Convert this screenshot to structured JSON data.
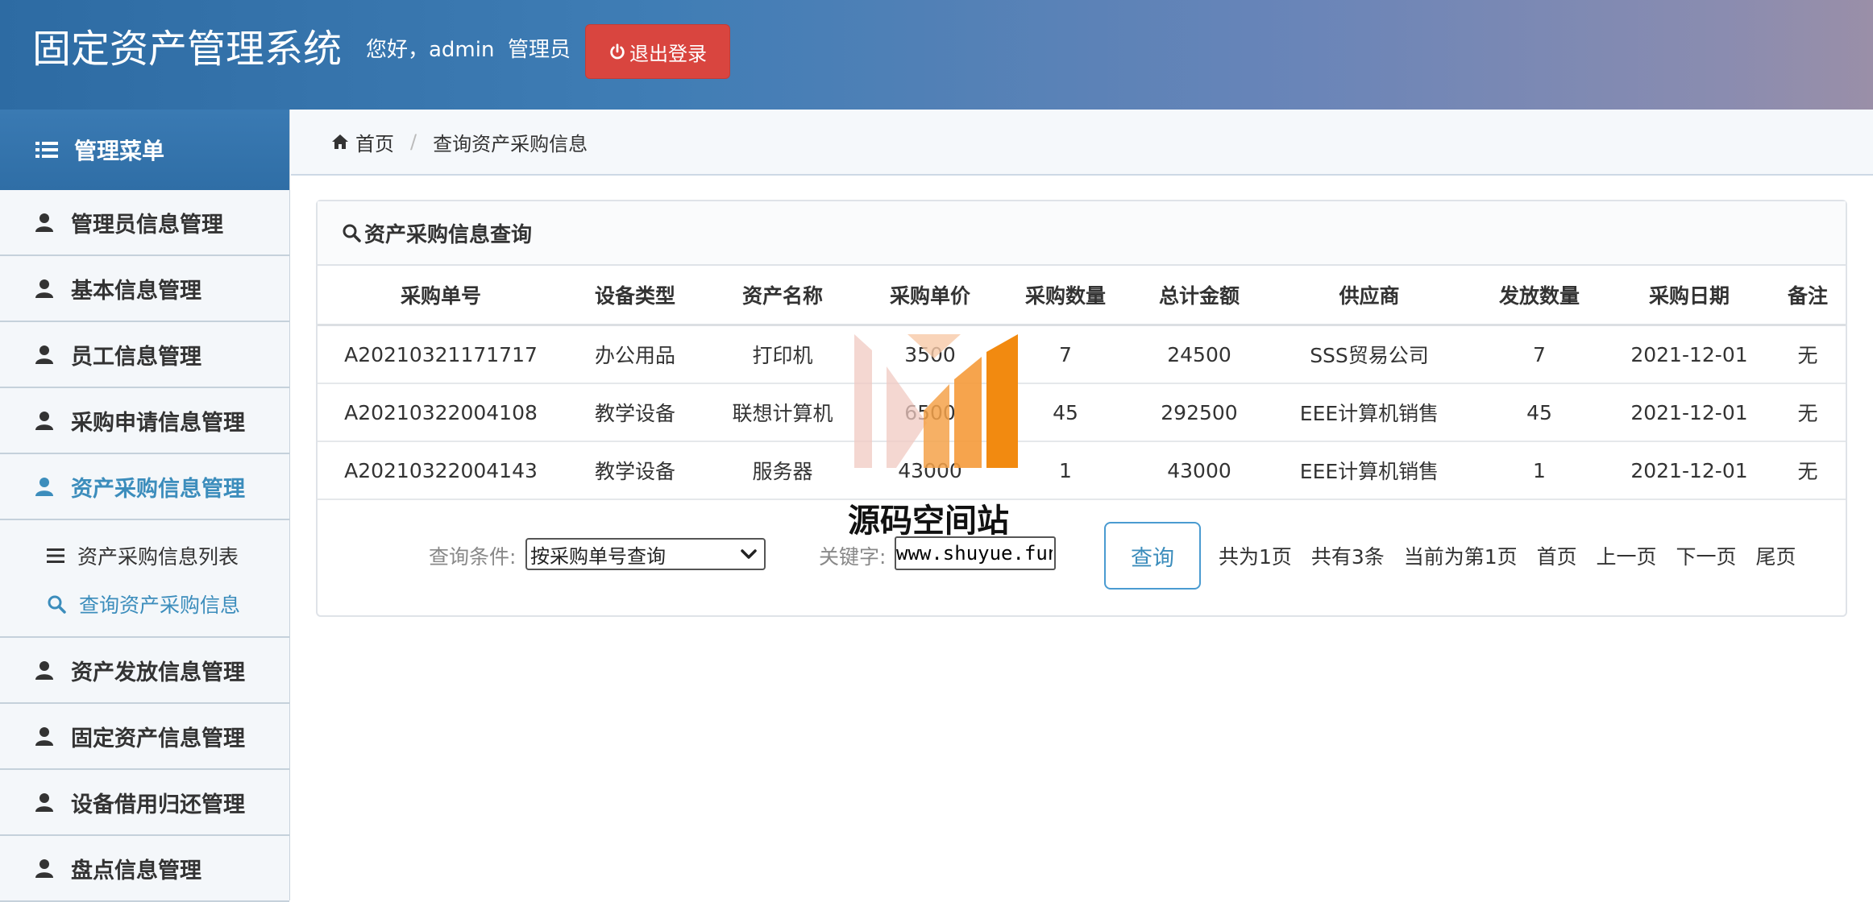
{
  "header": {
    "app_title": "固定资产管理系统",
    "greeting": "您好，admin  管理员",
    "logout_label": "退出登录"
  },
  "sidebar": {
    "menu_title": "管理菜单",
    "items": [
      {
        "label": "管理员信息管理"
      },
      {
        "label": "基本信息管理"
      },
      {
        "label": "员工信息管理"
      },
      {
        "label": "采购申请信息管理"
      },
      {
        "label": "资产采购信息管理",
        "active": true
      },
      {
        "label": "资产发放信息管理"
      },
      {
        "label": "固定资产信息管理"
      },
      {
        "label": "设备借用归还管理"
      },
      {
        "label": "盘点信息管理"
      }
    ],
    "submenu": [
      {
        "label": "资产采购信息列表",
        "icon": "list-icon"
      },
      {
        "label": "查询资产采购信息",
        "icon": "search-icon",
        "active": true
      }
    ]
  },
  "breadcrumb": {
    "home": "首页",
    "current": "查询资产采购信息"
  },
  "panel": {
    "title": "资产采购信息查询",
    "columns": [
      "采购单号",
      "设备类型",
      "资产名称",
      "采购单价",
      "采购数量",
      "总计金额",
      "供应商",
      "发放数量",
      "采购日期",
      "备注"
    ],
    "rows": [
      [
        "A20210321171717",
        "办公用品",
        "打印机",
        "3500",
        "7",
        "24500",
        "SSS贸易公司",
        "7",
        "2021-12-01",
        "无"
      ],
      [
        "A20210322004108",
        "教学设备",
        "联想计算机",
        "6500",
        "45",
        "292500",
        "EEE计算机销售",
        "45",
        "2021-12-01",
        "无"
      ],
      [
        "A20210322004143",
        "教学设备",
        "服务器",
        "43000",
        "1",
        "43000",
        "EEE计算机销售",
        "1",
        "2021-12-01",
        "无"
      ]
    ]
  },
  "search": {
    "condition_label": "查询条件:",
    "condition_value": "按采购单号查询",
    "keyword_label": "关键字:",
    "keyword_value": "www.shuyue.fun",
    "query_button": "查询"
  },
  "pager": {
    "total_pages": "共为1页",
    "total_records": "共有3条",
    "current_page": "当前为第1页",
    "first": "首页",
    "prev": "上一页",
    "next": "下一页",
    "last": "尾页"
  },
  "watermark": {
    "text": "源码空间站"
  },
  "colors": {
    "accent": "#3c8dbc",
    "danger": "#d9453f",
    "header_start": "#2d6ba3",
    "header_end": "#9a8fa8"
  }
}
